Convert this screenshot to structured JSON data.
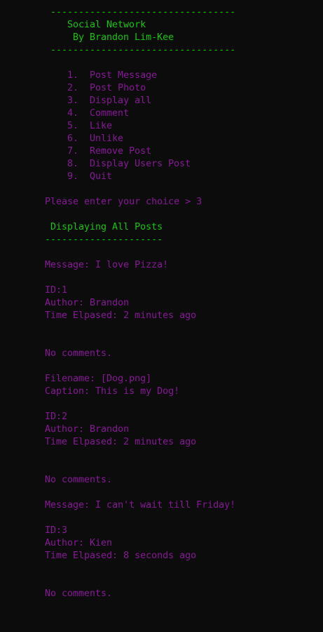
{
  "colors": {
    "background": "#0c0c0c",
    "green": "#16c60c",
    "purple": "#881798"
  },
  "header": {
    "rule": "---------------------------------",
    "title": "Social Network",
    "author": "By Brandon Lim-Kee"
  },
  "menu": [
    {
      "num": "1.",
      "label": "Post Message"
    },
    {
      "num": "2.",
      "label": "Post Photo"
    },
    {
      "num": "3.",
      "label": "Display all"
    },
    {
      "num": "4.",
      "label": "Comment"
    },
    {
      "num": "5.",
      "label": "Like"
    },
    {
      "num": "6.",
      "label": "Unlike"
    },
    {
      "num": "7.",
      "label": "Remove Post"
    },
    {
      "num": "8.",
      "label": "Display Users Post"
    },
    {
      "num": "9.",
      "label": "Quit"
    }
  ],
  "prompt": {
    "text": "Please enter your choice >",
    "input": "3"
  },
  "section": {
    "title": "Displaying All Posts",
    "rule": "---------------------"
  },
  "posts": [
    {
      "message": "Message: I love Pizza!",
      "id": "ID:1",
      "author": "Author: Brandon",
      "time": "Time Elpased: 2 minutes ago",
      "comments": "No comments."
    },
    {
      "filename": "Filename: [Dog.png]",
      "caption": "Caption: This is my Dog!",
      "id": "ID:2",
      "author": "Author: Brandon",
      "time": "Time Elpased: 2 minutes ago",
      "comments": "No comments."
    },
    {
      "message": "Message: I can't wait till Friday!",
      "id": "ID:3",
      "author": "Author: Kien",
      "time": "Time Elpased: 8 seconds ago",
      "comments": "No comments."
    }
  ]
}
